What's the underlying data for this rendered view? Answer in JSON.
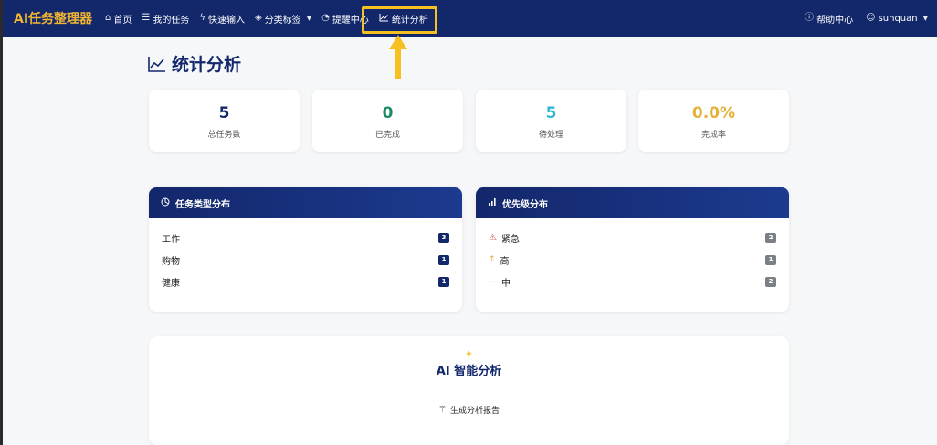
{
  "app": {
    "brand": "AI任务整理器"
  },
  "nav": {
    "items": [
      {
        "label": "首页",
        "icon": "home-icon"
      },
      {
        "label": "我的任务",
        "icon": "list-icon"
      },
      {
        "label": "快速输入",
        "icon": "lightning-icon"
      },
      {
        "label": "分类标签",
        "icon": "tag-icon",
        "has_dropdown": true
      },
      {
        "label": "提醒中心",
        "icon": "bell-icon"
      },
      {
        "label": "统计分析",
        "icon": "chart-line-icon",
        "active": true
      }
    ],
    "right": [
      {
        "label": "帮助中心",
        "icon": "help-icon"
      },
      {
        "label": "sunquan",
        "icon": "user-icon",
        "has_dropdown": true
      }
    ]
  },
  "page": {
    "title": "统计分析"
  },
  "stats": [
    {
      "value": "5",
      "label": "总任务数",
      "color": "#13276b"
    },
    {
      "value": "0",
      "label": "已完成",
      "color": "#1d8a6a"
    },
    {
      "value": "5",
      "label": "待处理",
      "color": "#2fb6d0"
    },
    {
      "value": "0.0%",
      "label": "完成率",
      "color": "#e4b23a"
    }
  ],
  "type_panel": {
    "title": "任务类型分布",
    "rows": [
      {
        "label": "工作",
        "count": "3"
      },
      {
        "label": "购物",
        "count": "1"
      },
      {
        "label": "健康",
        "count": "1"
      }
    ]
  },
  "priority_panel": {
    "title": "优先级分布",
    "rows": [
      {
        "label": "紧急",
        "count": "2",
        "icon": "warning-icon"
      },
      {
        "label": "高",
        "count": "1",
        "icon": "arrow-up-icon"
      },
      {
        "label": "中",
        "count": "2",
        "icon": "dash-icon"
      }
    ]
  },
  "ai": {
    "title": "AI 智能分析",
    "button_label": "生成分析报告"
  },
  "colors": {
    "navbar": "#13276b",
    "brand": "#f2b531",
    "highlight": "#f6c021"
  }
}
